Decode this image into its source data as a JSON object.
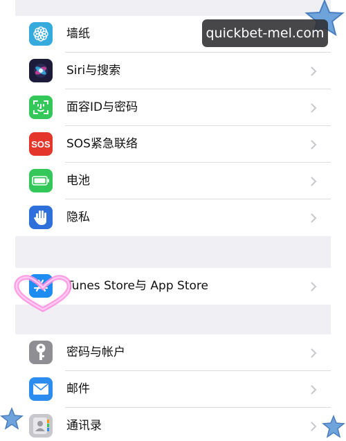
{
  "settings": {
    "group1": [
      {
        "label": "墙纸",
        "icon": "wallpaper-flower-icon",
        "color": "#35aadc"
      },
      {
        "label": "Siri与搜索",
        "icon": "siri-icon",
        "color": "#1c1c3a"
      },
      {
        "label": "面容ID与密码",
        "icon": "face-id-icon",
        "color": "#34c759"
      },
      {
        "label": "SOS紧急联络",
        "icon": "sos-icon",
        "color": "#e5362c",
        "icon_text": "SOS"
      },
      {
        "label": "电池",
        "icon": "battery-icon",
        "color": "#34c759"
      },
      {
        "label": "隐私",
        "icon": "privacy-hand-icon",
        "color": "#2e6fdb"
      }
    ],
    "group2": [
      {
        "label": "Tunes Store与 App Store",
        "icon": "app-store-icon",
        "color": "#1e8cf0"
      }
    ],
    "group3": [
      {
        "label": "密码与帐户",
        "icon": "key-icon",
        "color": "#8e8e93"
      },
      {
        "label": "邮件",
        "icon": "mail-icon",
        "color": "#2d8cf0"
      },
      {
        "label": "通讯录",
        "icon": "contacts-icon",
        "color": "#c8c8cc"
      }
    ]
  },
  "watermark": {
    "text": "quickbet-mel.com"
  },
  "colors": {
    "background": "#efeff4",
    "separator": "#dcdce0",
    "chevron": "#c7c7cc",
    "star": "#6fa3dc",
    "heart": "#ff8ce0"
  }
}
